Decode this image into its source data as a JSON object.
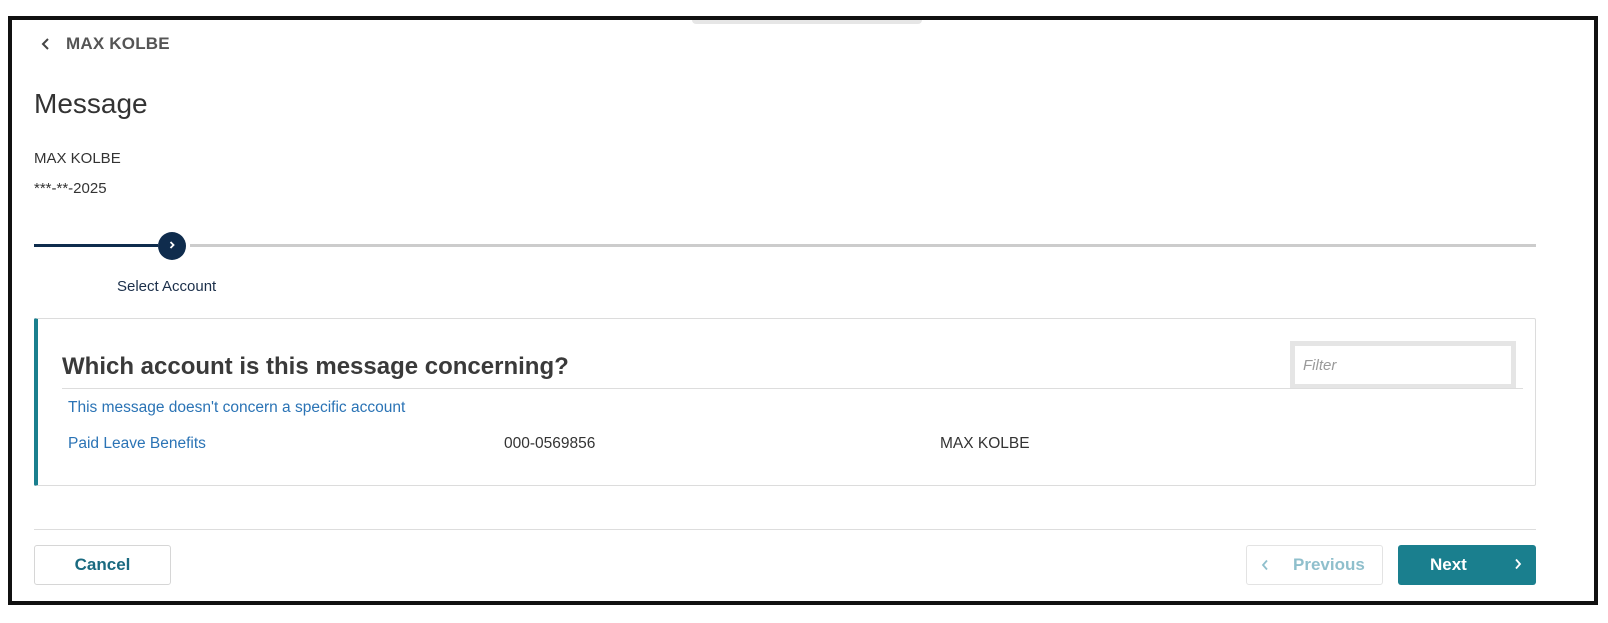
{
  "header": {
    "back_label": "MAX KOLBE",
    "back_icon": "chevron-left-icon"
  },
  "page": {
    "title": "Message"
  },
  "person": {
    "name": "MAX KOLBE",
    "id_masked": "***-**-2025"
  },
  "stepper": {
    "steps": [
      {
        "label": "Select Account",
        "state": "current",
        "icon": "chevron-right-icon"
      }
    ]
  },
  "account_selector": {
    "title": "Which account is this message concerning?",
    "filter": {
      "placeholder": "Filter",
      "value": ""
    },
    "no_account_option": "This message doesn't concern a specific account",
    "accounts": [
      {
        "name": "Paid Leave Benefits",
        "number": "000-0569856",
        "holder": "MAX KOLBE"
      }
    ]
  },
  "footer": {
    "cancel_label": "Cancel",
    "previous_label": "Previous",
    "next_label": "Next"
  },
  "colors": {
    "navy": "#0f2c4d",
    "teal": "#1a7f8e",
    "link_blue": "#2a73b5",
    "disabled_teal": "#8fbfcc"
  }
}
